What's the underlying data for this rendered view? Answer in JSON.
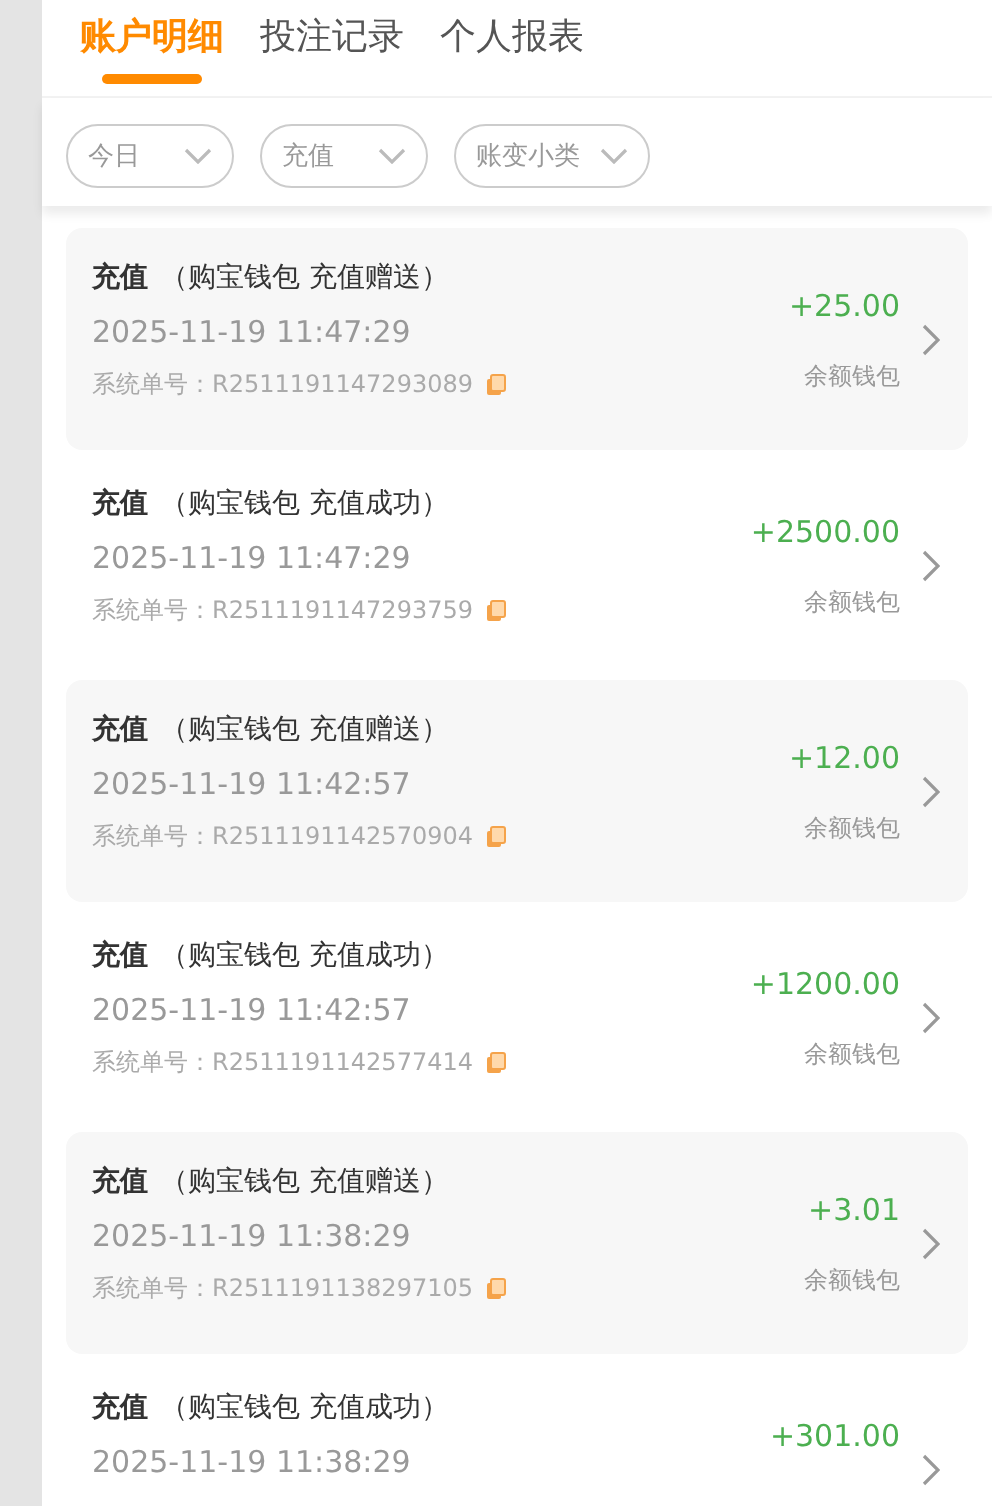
{
  "tabs": [
    {
      "label": "账户明细",
      "selected": true
    },
    {
      "label": "投注记录",
      "selected": false
    },
    {
      "label": "个人报表",
      "selected": false
    }
  ],
  "filters": [
    {
      "label": "今日"
    },
    {
      "label": "充值"
    },
    {
      "label": "账变小类"
    }
  ],
  "records": [
    {
      "type": "充值",
      "detail": "（购宝钱包 充值赠送）",
      "time": "2025-11-19 11:47:29",
      "order_label": "系统单号：",
      "order_no": "R2511191147293089",
      "amount": "+25.00",
      "wallet": "余额钱包"
    },
    {
      "type": "充值",
      "detail": "（购宝钱包 充值成功）",
      "time": "2025-11-19 11:47:29",
      "order_label": "系统单号：",
      "order_no": "R2511191147293759",
      "amount": "+2500.00",
      "wallet": "余额钱包"
    },
    {
      "type": "充值",
      "detail": "（购宝钱包 充值赠送）",
      "time": "2025-11-19 11:42:57",
      "order_label": "系统单号：",
      "order_no": "R2511191142570904",
      "amount": "+12.00",
      "wallet": "余额钱包"
    },
    {
      "type": "充值",
      "detail": "（购宝钱包 充值成功）",
      "time": "2025-11-19 11:42:57",
      "order_label": "系统单号：",
      "order_no": "R2511191142577414",
      "amount": "+1200.00",
      "wallet": "余额钱包"
    },
    {
      "type": "充值",
      "detail": "（购宝钱包 充值赠送）",
      "time": "2025-11-19 11:38:29",
      "order_label": "系统单号：",
      "order_no": "R2511191138297105",
      "amount": "+3.01",
      "wallet": "余额钱包"
    },
    {
      "type": "充值",
      "detail": "（购宝钱包 充值成功）",
      "time": "2025-11-19 11:38:29",
      "amount": "+301.00"
    }
  ]
}
